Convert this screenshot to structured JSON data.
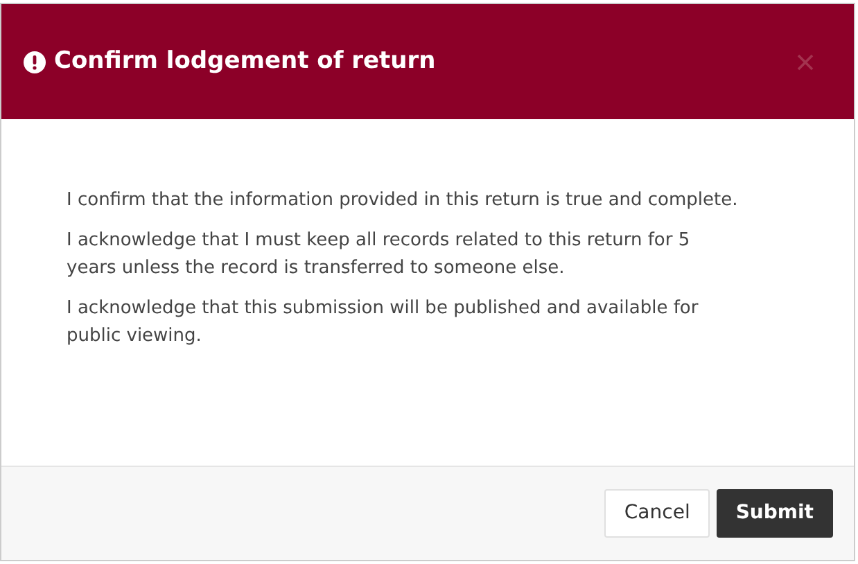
{
  "dialog": {
    "title": "Confirm lodgement of return",
    "paragraphs": [
      "I confirm that the information provided in this return is true and complete.",
      "I acknowledge that I must keep all records related to this return for 5 years unless the record is transferred to someone else.",
      "I acknowledge that this submission will be published and available for public viewing."
    ],
    "buttons": [
      {
        "label": "Cancel",
        "kind": "secondary"
      },
      {
        "label": "Submit",
        "kind": "primary"
      }
    ]
  }
}
